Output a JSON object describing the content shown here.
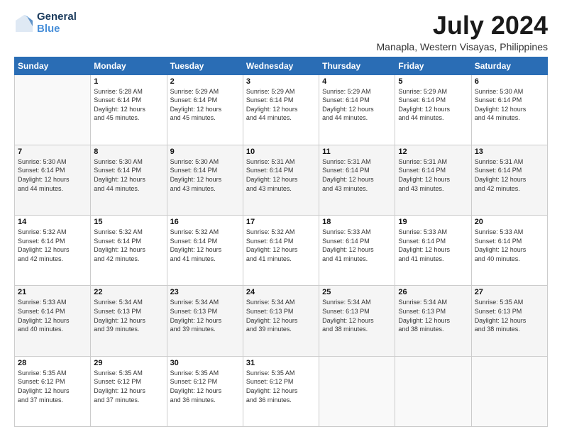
{
  "logo": {
    "line1": "General",
    "line2": "Blue"
  },
  "title": "July 2024",
  "subtitle": "Manapla, Western Visayas, Philippines",
  "weekdays": [
    "Sunday",
    "Monday",
    "Tuesday",
    "Wednesday",
    "Thursday",
    "Friday",
    "Saturday"
  ],
  "weeks": [
    [
      {
        "day": "",
        "sunrise": "",
        "sunset": "",
        "daylight": ""
      },
      {
        "day": "1",
        "sunrise": "5:28 AM",
        "sunset": "6:14 PM",
        "daylight": "12 hours and 45 minutes."
      },
      {
        "day": "2",
        "sunrise": "5:29 AM",
        "sunset": "6:14 PM",
        "daylight": "12 hours and 45 minutes."
      },
      {
        "day": "3",
        "sunrise": "5:29 AM",
        "sunset": "6:14 PM",
        "daylight": "12 hours and 44 minutes."
      },
      {
        "day": "4",
        "sunrise": "5:29 AM",
        "sunset": "6:14 PM",
        "daylight": "12 hours and 44 minutes."
      },
      {
        "day": "5",
        "sunrise": "5:29 AM",
        "sunset": "6:14 PM",
        "daylight": "12 hours and 44 minutes."
      },
      {
        "day": "6",
        "sunrise": "5:30 AM",
        "sunset": "6:14 PM",
        "daylight": "12 hours and 44 minutes."
      }
    ],
    [
      {
        "day": "7",
        "sunrise": "5:30 AM",
        "sunset": "6:14 PM",
        "daylight": "12 hours and 44 minutes."
      },
      {
        "day": "8",
        "sunrise": "5:30 AM",
        "sunset": "6:14 PM",
        "daylight": "12 hours and 44 minutes."
      },
      {
        "day": "9",
        "sunrise": "5:30 AM",
        "sunset": "6:14 PM",
        "daylight": "12 hours and 43 minutes."
      },
      {
        "day": "10",
        "sunrise": "5:31 AM",
        "sunset": "6:14 PM",
        "daylight": "12 hours and 43 minutes."
      },
      {
        "day": "11",
        "sunrise": "5:31 AM",
        "sunset": "6:14 PM",
        "daylight": "12 hours and 43 minutes."
      },
      {
        "day": "12",
        "sunrise": "5:31 AM",
        "sunset": "6:14 PM",
        "daylight": "12 hours and 43 minutes."
      },
      {
        "day": "13",
        "sunrise": "5:31 AM",
        "sunset": "6:14 PM",
        "daylight": "12 hours and 42 minutes."
      }
    ],
    [
      {
        "day": "14",
        "sunrise": "5:32 AM",
        "sunset": "6:14 PM",
        "daylight": "12 hours and 42 minutes."
      },
      {
        "day": "15",
        "sunrise": "5:32 AM",
        "sunset": "6:14 PM",
        "daylight": "12 hours and 42 minutes."
      },
      {
        "day": "16",
        "sunrise": "5:32 AM",
        "sunset": "6:14 PM",
        "daylight": "12 hours and 41 minutes."
      },
      {
        "day": "17",
        "sunrise": "5:32 AM",
        "sunset": "6:14 PM",
        "daylight": "12 hours and 41 minutes."
      },
      {
        "day": "18",
        "sunrise": "5:33 AM",
        "sunset": "6:14 PM",
        "daylight": "12 hours and 41 minutes."
      },
      {
        "day": "19",
        "sunrise": "5:33 AM",
        "sunset": "6:14 PM",
        "daylight": "12 hours and 41 minutes."
      },
      {
        "day": "20",
        "sunrise": "5:33 AM",
        "sunset": "6:14 PM",
        "daylight": "12 hours and 40 minutes."
      }
    ],
    [
      {
        "day": "21",
        "sunrise": "5:33 AM",
        "sunset": "6:14 PM",
        "daylight": "12 hours and 40 minutes."
      },
      {
        "day": "22",
        "sunrise": "5:34 AM",
        "sunset": "6:13 PM",
        "daylight": "12 hours and 39 minutes."
      },
      {
        "day": "23",
        "sunrise": "5:34 AM",
        "sunset": "6:13 PM",
        "daylight": "12 hours and 39 minutes."
      },
      {
        "day": "24",
        "sunrise": "5:34 AM",
        "sunset": "6:13 PM",
        "daylight": "12 hours and 39 minutes."
      },
      {
        "day": "25",
        "sunrise": "5:34 AM",
        "sunset": "6:13 PM",
        "daylight": "12 hours and 38 minutes."
      },
      {
        "day": "26",
        "sunrise": "5:34 AM",
        "sunset": "6:13 PM",
        "daylight": "12 hours and 38 minutes."
      },
      {
        "day": "27",
        "sunrise": "5:35 AM",
        "sunset": "6:13 PM",
        "daylight": "12 hours and 38 minutes."
      }
    ],
    [
      {
        "day": "28",
        "sunrise": "5:35 AM",
        "sunset": "6:12 PM",
        "daylight": "12 hours and 37 minutes."
      },
      {
        "day": "29",
        "sunrise": "5:35 AM",
        "sunset": "6:12 PM",
        "daylight": "12 hours and 37 minutes."
      },
      {
        "day": "30",
        "sunrise": "5:35 AM",
        "sunset": "6:12 PM",
        "daylight": "12 hours and 36 minutes."
      },
      {
        "day": "31",
        "sunrise": "5:35 AM",
        "sunset": "6:12 PM",
        "daylight": "12 hours and 36 minutes."
      },
      {
        "day": "",
        "sunrise": "",
        "sunset": "",
        "daylight": ""
      },
      {
        "day": "",
        "sunrise": "",
        "sunset": "",
        "daylight": ""
      },
      {
        "day": "",
        "sunrise": "",
        "sunset": "",
        "daylight": ""
      }
    ]
  ]
}
